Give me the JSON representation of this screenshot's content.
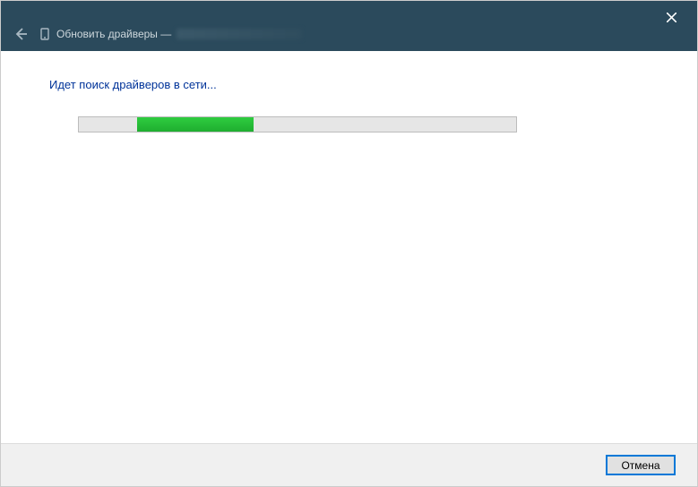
{
  "titlebar": {
    "title_prefix": "Обновить драйверы —"
  },
  "content": {
    "status": "Идет поиск драйверов в сети..."
  },
  "footer": {
    "cancel_label": "Отмена"
  }
}
